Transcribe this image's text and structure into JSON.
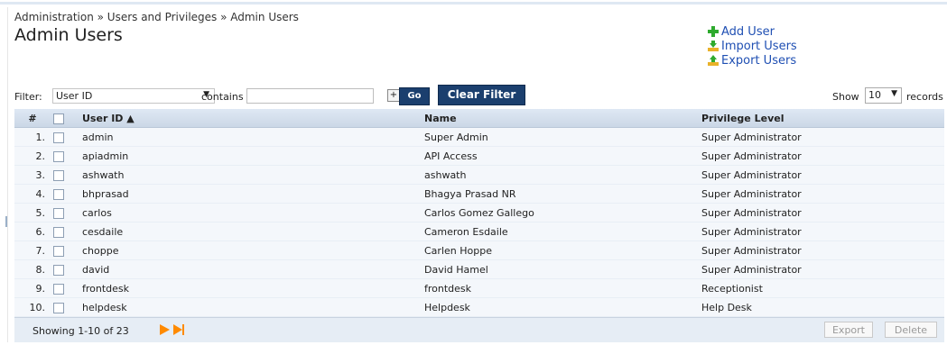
{
  "breadcrumb": "Administration » Users and Privileges » Admin Users",
  "title": "Admin Users",
  "actions": [
    {
      "label": "Add User",
      "icon": "add-user-icon"
    },
    {
      "label": "Import Users",
      "icon": "import-users-icon"
    },
    {
      "label": "Export Users",
      "icon": "export-users-icon"
    }
  ],
  "filter": {
    "label": "Filter:",
    "field_value": "User ID",
    "contains_label": "contains",
    "text_value": "",
    "go_label": "Go",
    "clear_label": "Clear Filter"
  },
  "show": {
    "label": "Show",
    "value": "10",
    "suffix": "records"
  },
  "table": {
    "columns": [
      "#",
      "",
      "User ID ▲",
      "Name",
      "Privilege Level"
    ],
    "rows": [
      {
        "num": "1.",
        "user_id": "admin",
        "name": "Super Admin",
        "privilege": "Super Administrator"
      },
      {
        "num": "2.",
        "user_id": "apiadmin",
        "name": "API Access",
        "privilege": "Super Administrator"
      },
      {
        "num": "3.",
        "user_id": "ashwath",
        "name": "ashwath",
        "privilege": "Super Administrator"
      },
      {
        "num": "4.",
        "user_id": "bhprasad",
        "name": "Bhagya Prasad NR",
        "privilege": "Super Administrator"
      },
      {
        "num": "5.",
        "user_id": "carlos",
        "name": "Carlos Gomez Gallego",
        "privilege": "Super Administrator"
      },
      {
        "num": "6.",
        "user_id": "cesdaile",
        "name": "Cameron Esdaile",
        "privilege": "Super Administrator"
      },
      {
        "num": "7.",
        "user_id": "choppe",
        "name": "Carlen Hoppe",
        "privilege": "Super Administrator"
      },
      {
        "num": "8.",
        "user_id": "david",
        "name": "David Hamel",
        "privilege": "Super Administrator"
      },
      {
        "num": "9.",
        "user_id": "frontdesk",
        "name": "frontdesk",
        "privilege": "Receptionist"
      },
      {
        "num": "10.",
        "user_id": "helpdesk",
        "name": "Helpdesk",
        "privilege": "Help Desk"
      }
    ]
  },
  "footer": {
    "showing": "Showing 1-10 of 23",
    "export_label": "Export",
    "delete_label": "Delete"
  },
  "colors": {
    "accent": "#1b3f6e",
    "link": "#1f4fb3",
    "pager": "#ff8a00"
  }
}
